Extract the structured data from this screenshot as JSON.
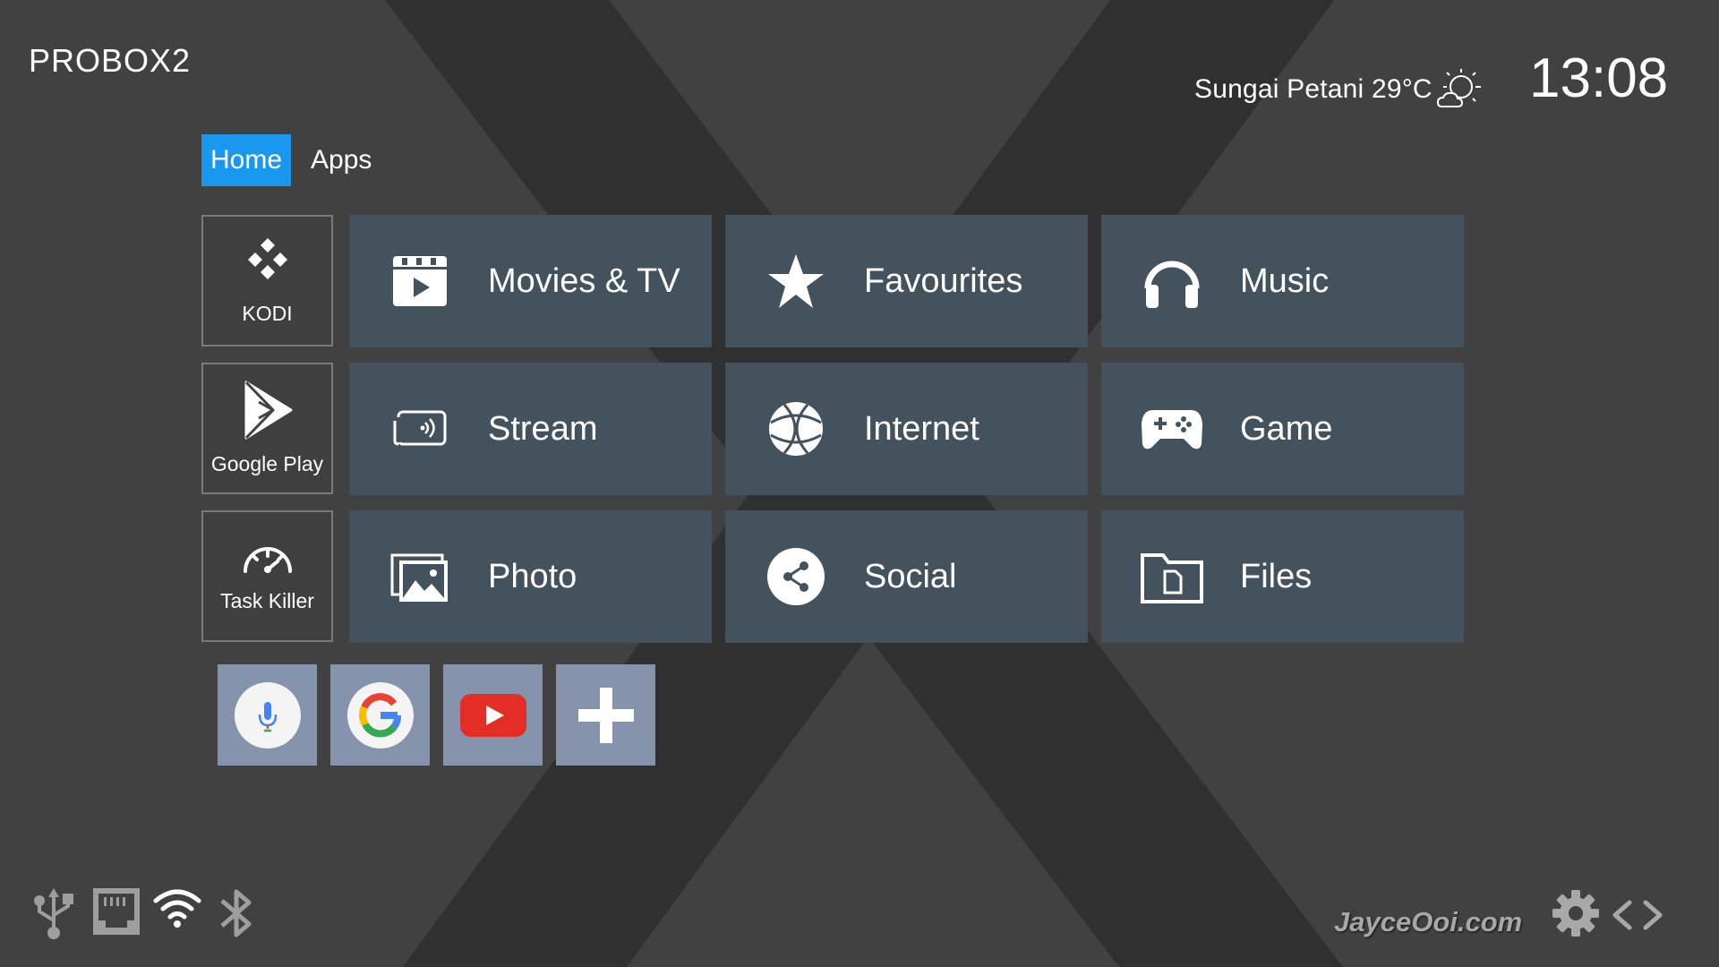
{
  "brand": {
    "logo_text": "PROBOX2"
  },
  "weather": {
    "location_temp": "Sungai Petani 29°C",
    "icon": "partly-cloudy-sun-icon"
  },
  "clock": {
    "time": "13:08"
  },
  "tabs": [
    {
      "label": "Home",
      "active": true
    },
    {
      "label": "Apps",
      "active": false
    }
  ],
  "side_apps": [
    {
      "label": "KODI",
      "icon": "kodi-icon"
    },
    {
      "label": "Google Play",
      "icon": "play-store-icon"
    },
    {
      "label": "Task Killer",
      "icon": "speedometer-icon"
    }
  ],
  "categories": [
    {
      "label": "Movies & TV",
      "icon": "clapperboard-icon"
    },
    {
      "label": "Favourites",
      "icon": "star-icon"
    },
    {
      "label": "Music",
      "icon": "headphones-icon"
    },
    {
      "label": "Stream",
      "icon": "cast-screen-icon"
    },
    {
      "label": "Internet",
      "icon": "globe-icon"
    },
    {
      "label": "Game",
      "icon": "gamepad-icon"
    },
    {
      "label": "Photo",
      "icon": "photos-icon"
    },
    {
      "label": "Social",
      "icon": "share-icon"
    },
    {
      "label": "Files",
      "icon": "folder-file-icon"
    }
  ],
  "shortcuts": [
    {
      "icon": "voice-search-mic-icon"
    },
    {
      "icon": "google-g-icon"
    },
    {
      "icon": "youtube-icon"
    },
    {
      "icon": "add-icon"
    }
  ],
  "status_icons": [
    "usb-icon",
    "ethernet-icon",
    "wifi-icon",
    "bluetooth-icon"
  ],
  "footer": {
    "watermark": "JayceOoi.com",
    "settings_icon": "gear-icon",
    "nav_icon": "code-arrows-icon"
  },
  "colors": {
    "tab_active": "#1a97ee",
    "tile": "#44525d",
    "shortcut_bg": "#8593ad",
    "background": "#414141"
  }
}
